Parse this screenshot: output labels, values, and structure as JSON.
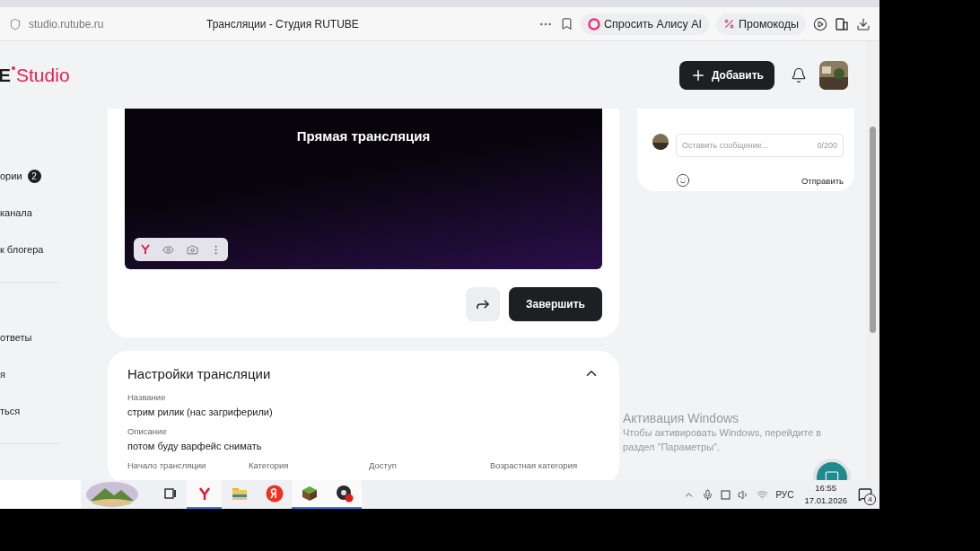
{
  "browser": {
    "address": "studio.rutube.ru",
    "page_title": "Трансляции - Студия RUTUBE",
    "alice_button": "Спросить Алису AI",
    "promo_button": "Промокоды"
  },
  "header": {
    "logo_cut": "E",
    "logo_product": "Studio",
    "add_button": "Добавить"
  },
  "sidebar": {
    "sections": [
      [
        {
          "label": "ории",
          "badge": "2"
        },
        {
          "label": "канала"
        },
        {
          "label": "к блогера"
        }
      ],
      [
        {
          "label": "ответы"
        },
        {
          "label": "я"
        },
        {
          "label": "ться"
        }
      ]
    ]
  },
  "stream": {
    "title": "Прямая трансляция",
    "finish_button": "Завершить"
  },
  "settings": {
    "title": "Настройки трансляции",
    "expanded": true,
    "fields": [
      {
        "label": "Название",
        "value": "стрим рилик (нас загриферили)"
      },
      {
        "label": "Описание",
        "value": "потом буду варфейс снимать"
      }
    ],
    "columns": [
      "Начало трансляции",
      "Категория",
      "Доступ",
      "Возрастная категория"
    ]
  },
  "chat": {
    "placeholder": "Оставить сообщение...",
    "counter": "0/200",
    "send_button": "Отправить"
  },
  "activation": {
    "title": "Активация Windows",
    "text": "Чтобы активировать Windows, перейдите в раздел \"Параметры\"."
  },
  "taskbar": {
    "apps": [
      {
        "kind": "taskview",
        "active": false
      },
      {
        "kind": "browser",
        "active": true
      },
      {
        "kind": "explorer",
        "active": false
      },
      {
        "kind": "yandex",
        "active": false
      },
      {
        "kind": "minecraft",
        "active": true
      },
      {
        "kind": "obs",
        "active": true
      }
    ],
    "language": "РУС",
    "time": "16:55",
    "date": "17.01.2026",
    "notifications": "4"
  }
}
